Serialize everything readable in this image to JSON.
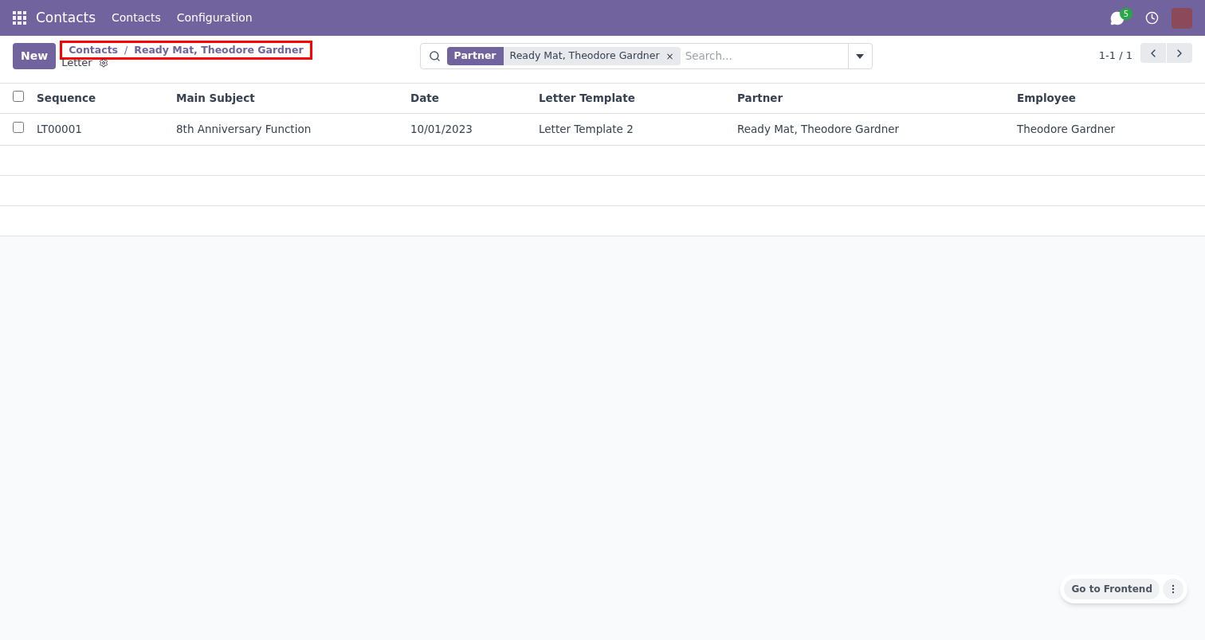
{
  "navbar": {
    "app_name": "Contacts",
    "menu": [
      "Contacts",
      "Configuration"
    ],
    "message_count": "5"
  },
  "control_panel": {
    "new_button": "New",
    "breadcrumb": [
      "Contacts",
      "Ready Mat, Theodore Gardner"
    ],
    "breadcrumb_separator": "/",
    "breadcrumb_highlighted": true,
    "page_title": "Letter",
    "search": {
      "facet_label": "Partner",
      "facet_value": "Ready Mat, Theodore Gardner",
      "facet_remove": "×",
      "placeholder": "Search..."
    },
    "pager": "1-1 / 1"
  },
  "table": {
    "select_all_checked": false,
    "columns": [
      "Sequence",
      "Main Subject",
      "Date",
      "Letter Template",
      "Partner",
      "Employee"
    ],
    "rows": [
      {
        "checked": false,
        "cells": [
          "LT00001",
          "8th Anniversary Function",
          "10/01/2023",
          "Letter Template 2",
          "Ready Mat, Theodore Gardner",
          "Theodore Gardner"
        ]
      }
    ]
  },
  "frontend_button": "Go to Frontend"
}
